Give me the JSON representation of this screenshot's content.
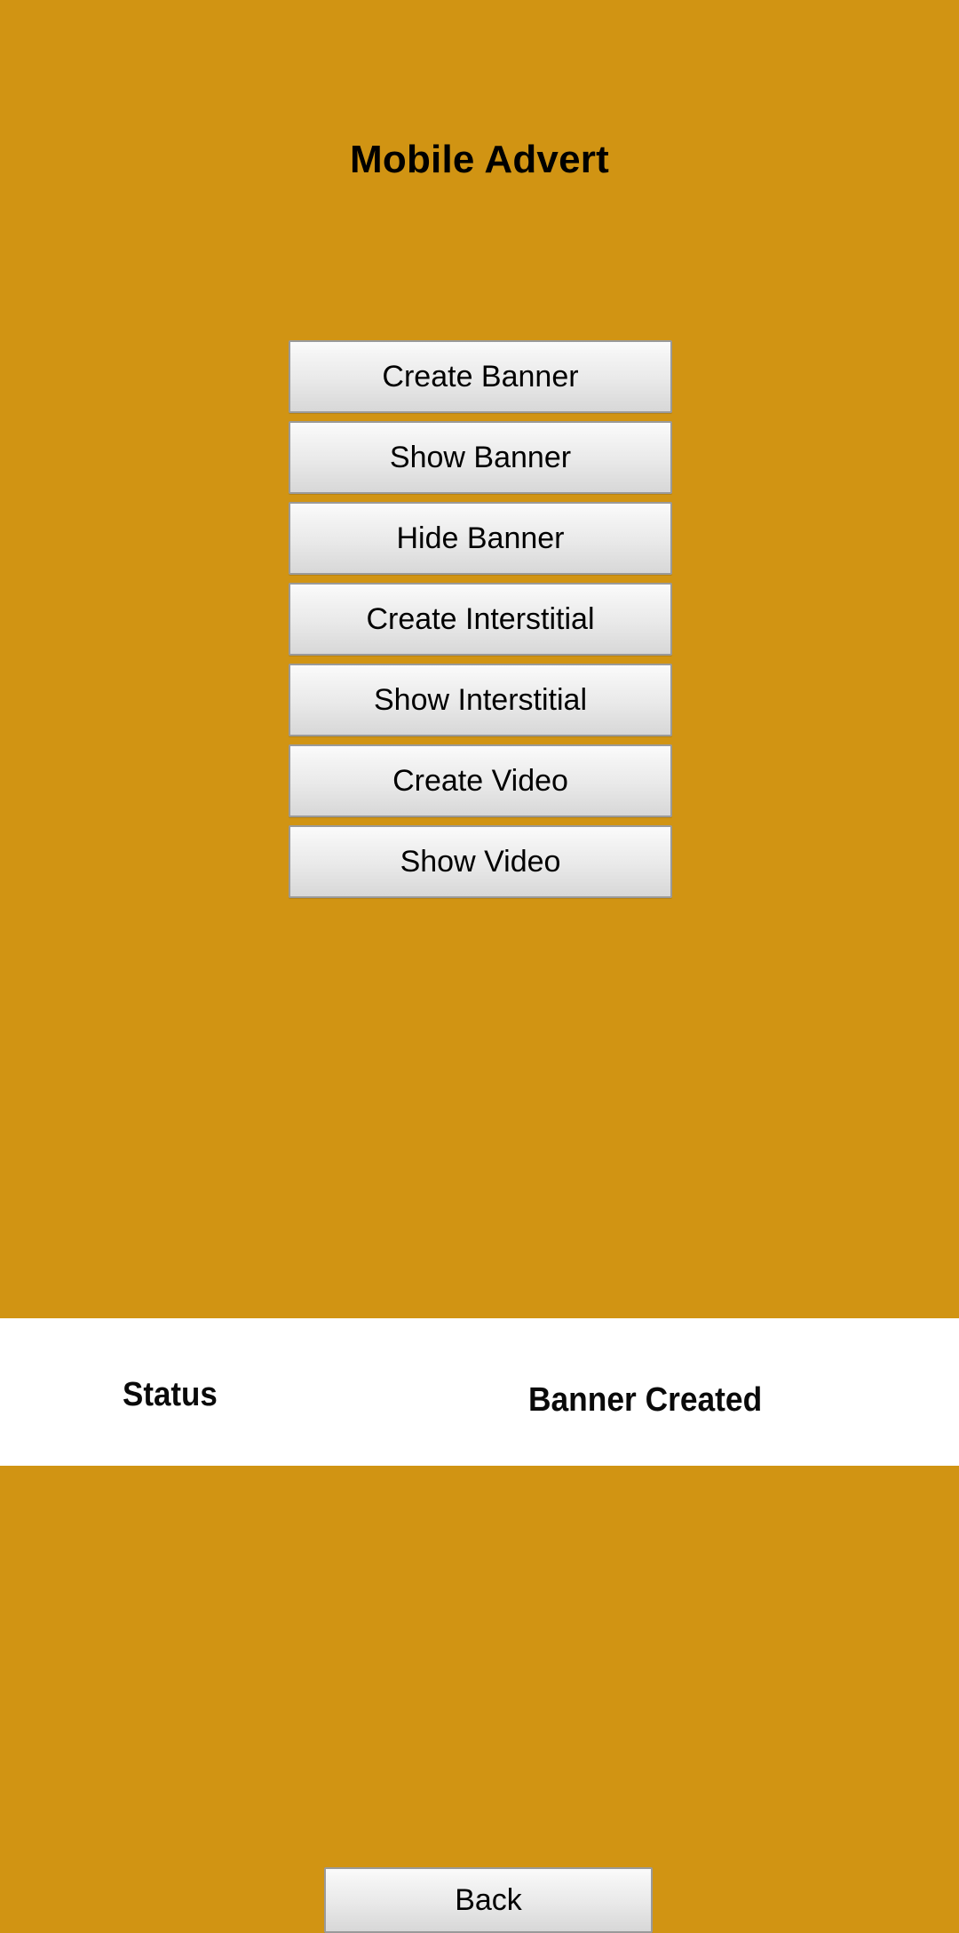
{
  "app": {
    "title": "Mobile Advert",
    "background_color": "#d19413",
    "panel_color": "#ffffff",
    "button_face_color": "#eaeaea",
    "button_border_color": "#9a9a9a",
    "text_color": "#000000"
  },
  "actions": [
    {
      "id": "create-banner",
      "label": "Create Banner"
    },
    {
      "id": "show-banner",
      "label": "Show Banner"
    },
    {
      "id": "hide-banner",
      "label": "Hide Banner"
    },
    {
      "id": "create-interstitial",
      "label": "Create Interstitial"
    },
    {
      "id": "show-interstitial",
      "label": "Show Interstitial"
    },
    {
      "id": "create-video",
      "label": "Create Video"
    },
    {
      "id": "show-video",
      "label": "Show Video"
    }
  ],
  "status": {
    "label": "Status",
    "value": "Banner Created"
  },
  "footer": {
    "back_label": "Back"
  }
}
